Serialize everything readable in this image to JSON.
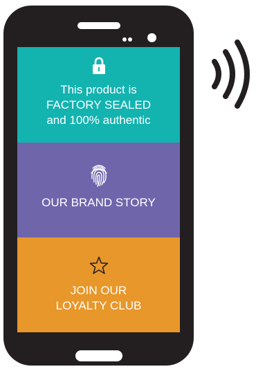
{
  "panels": [
    {
      "icon": "lock-icon",
      "text": "This product is\nFACTORY SEALED\nand 100% authentic",
      "color": "#13b3b0"
    },
    {
      "icon": "fingerprint-icon",
      "text": "OUR BRAND STORY",
      "color": "#6f65ab"
    },
    {
      "icon": "star-icon",
      "text": "JOIN OUR\nLOYALTY CLUB",
      "color": "#e8972b"
    }
  ],
  "device": {
    "body_color": "#231f20",
    "signal_icon": "nfc-waves-icon"
  }
}
